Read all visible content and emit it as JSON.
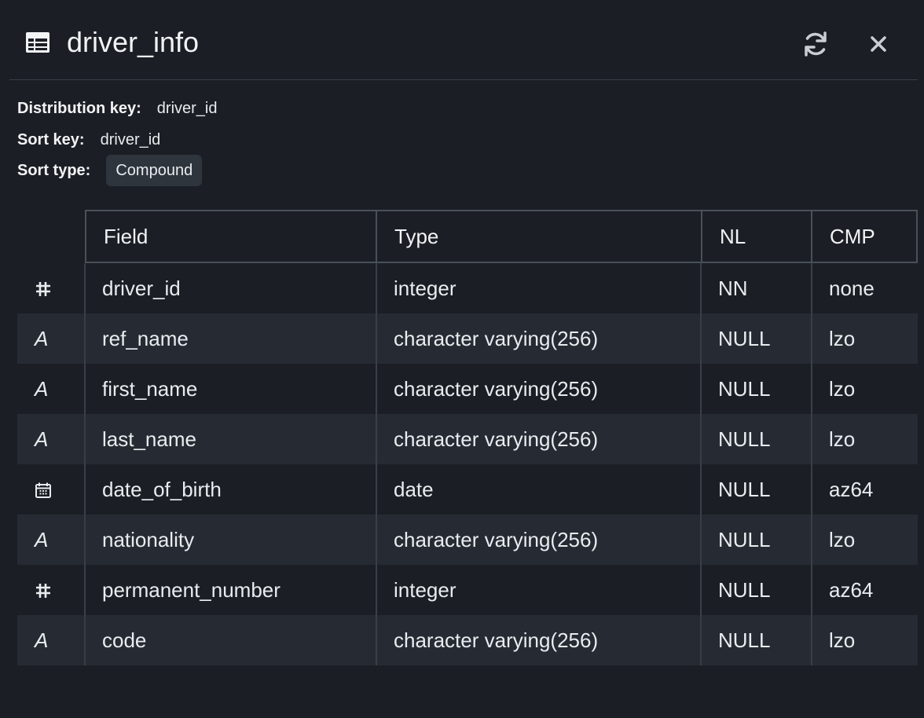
{
  "header": {
    "title": "driver_info",
    "icons": {
      "table": "table-icon",
      "refresh": "refresh-icon",
      "close": "close-icon"
    }
  },
  "meta": {
    "distribution_key_label": "Distribution key:",
    "distribution_key_value": "driver_id",
    "sort_key_label": "Sort key:",
    "sort_key_value": "driver_id",
    "sort_type_label": "Sort type:",
    "sort_type_value": "Compound"
  },
  "table": {
    "columns": [
      "Field",
      "Type",
      "NL",
      "CMP"
    ],
    "rows": [
      {
        "icon": "number-grid-icon",
        "field": "driver_id",
        "type": "integer",
        "nl": "NN",
        "cmp": "none"
      },
      {
        "icon": "text-a-icon",
        "icon_glyph": "A",
        "field": "ref_name",
        "type": "character varying(256)",
        "nl": "NULL",
        "cmp": "lzo"
      },
      {
        "icon": "text-a-icon",
        "icon_glyph": "A",
        "field": "first_name",
        "type": "character varying(256)",
        "nl": "NULL",
        "cmp": "lzo"
      },
      {
        "icon": "text-a-icon",
        "icon_glyph": "A",
        "field": "last_name",
        "type": "character varying(256)",
        "nl": "NULL",
        "cmp": "lzo"
      },
      {
        "icon": "calendar-icon",
        "field": "date_of_birth",
        "type": "date",
        "nl": "NULL",
        "cmp": "az64"
      },
      {
        "icon": "text-a-icon",
        "icon_glyph": "A",
        "field": "nationality",
        "type": "character varying(256)",
        "nl": "NULL",
        "cmp": "lzo"
      },
      {
        "icon": "number-grid-icon",
        "field": "permanent_number",
        "type": "integer",
        "nl": "NULL",
        "cmp": "az64"
      },
      {
        "icon": "text-a-icon",
        "icon_glyph": "A",
        "field": "code",
        "type": "character varying(256)",
        "nl": "NULL",
        "cmp": "lzo"
      }
    ]
  },
  "colors": {
    "background": "#1b1f25",
    "row_alt": "#262b33",
    "border": "#4a5058",
    "text": "#e9ecef"
  }
}
